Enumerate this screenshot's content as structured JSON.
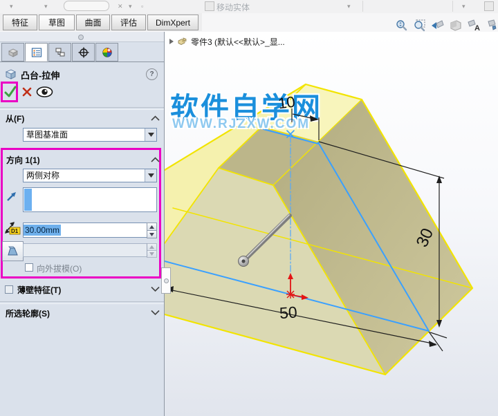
{
  "toolbar_top": {
    "move_entities_label": "移动实体"
  },
  "ribbon_tabs": {
    "features": "特征",
    "sketch": "草图",
    "surfaces": "曲面",
    "evaluate": "评估",
    "dimxpert": "DimXpert"
  },
  "headsup_toolbar": {
    "icons": [
      "zoom-to-fit",
      "zoom-to-area",
      "previous-view",
      "section-view",
      "hide-show-annotations",
      "view-settings"
    ]
  },
  "manager_tabs": [
    "feature-manager",
    "property-manager",
    "configuration-manager",
    "dimxpert-manager",
    "display-manager"
  ],
  "property_manager": {
    "title": "凸台-拉伸",
    "help": "?",
    "from_section": {
      "label": "从(F)",
      "value": "草图基准面"
    },
    "direction1_section": {
      "label": "方向 1(1)",
      "end_condition": "两侧对称",
      "depth_value": "30.00mm",
      "draft_outward_label": "向外拔模(O)"
    },
    "thin_feature_section": {
      "label": "薄壁特征(T)"
    },
    "selected_contours_section": {
      "label": "所选轮廓(S)"
    }
  },
  "viewport": {
    "breadcrumb": "零件3  (默认<<默认>_显...",
    "watermark": {
      "line1": "软件自学网",
      "line2": "WWW.RJZXW.COM"
    },
    "dimensions": {
      "top_width": "10",
      "height": "30",
      "base_width": "50"
    }
  },
  "colors": {
    "highlight_magenta": "#ea00c4",
    "preview_edge_yellow": "#f2e400",
    "sketch_blue": "#3aa0ff",
    "origin_red": "#e41414",
    "watermark_blue": "#1b8fdc",
    "face_bright": "#f6f2b2",
    "face_front": "#dbd9b3",
    "face_dark": "#bdb78c"
  }
}
